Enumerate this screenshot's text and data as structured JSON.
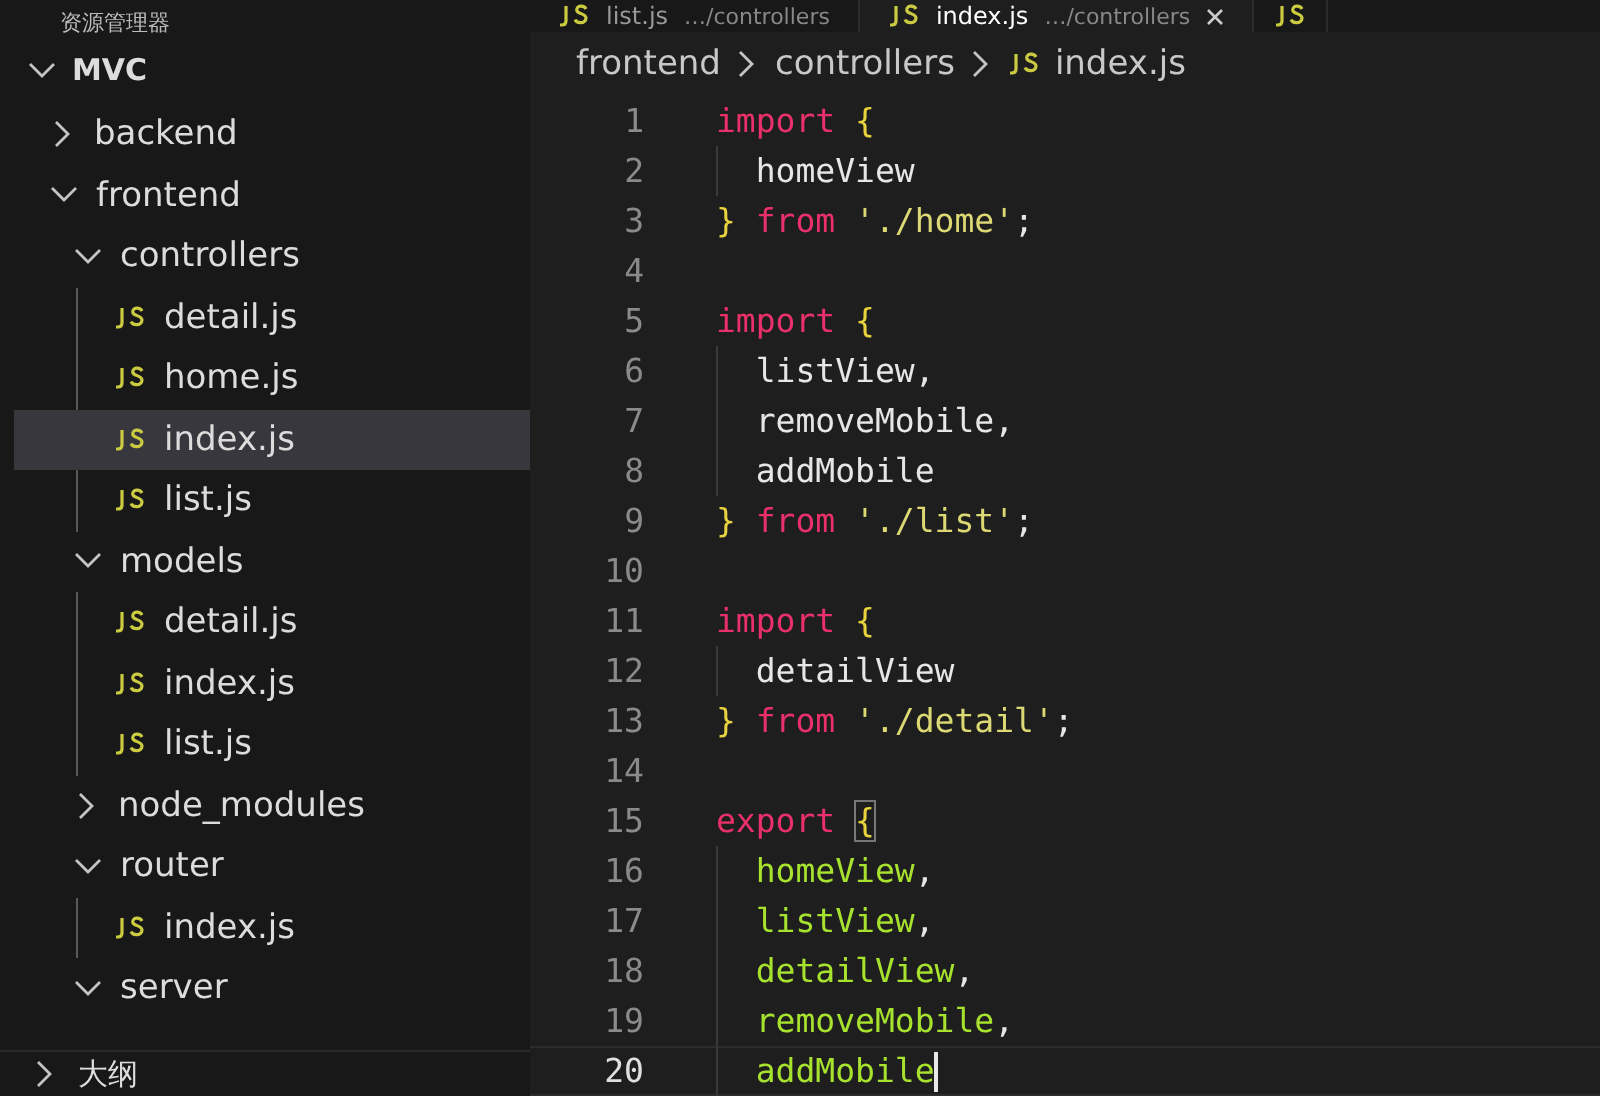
{
  "sidebar": {
    "title": "资源管理器",
    "root": {
      "label": "MVC",
      "expanded": true
    },
    "tree": [
      {
        "kind": "folder",
        "label": "backend",
        "expanded": false,
        "selected": false
      },
      {
        "kind": "folder",
        "label": "frontend",
        "expanded": true,
        "selected": false,
        "children": [
          {
            "kind": "folder",
            "label": "controllers",
            "expanded": true,
            "selected": false,
            "children": [
              {
                "kind": "file",
                "label": "detail.js",
                "selected": false
              },
              {
                "kind": "file",
                "label": "home.js",
                "selected": false
              },
              {
                "kind": "file",
                "label": "index.js",
                "selected": true
              },
              {
                "kind": "file",
                "label": "list.js",
                "selected": false
              }
            ]
          },
          {
            "kind": "folder",
            "label": "models",
            "expanded": true,
            "selected": false,
            "children": [
              {
                "kind": "file",
                "label": "detail.js",
                "selected": false
              },
              {
                "kind": "file",
                "label": "index.js",
                "selected": false
              },
              {
                "kind": "file",
                "label": "list.js",
                "selected": false
              }
            ]
          },
          {
            "kind": "folder",
            "label": "node_modules",
            "expanded": false,
            "selected": false
          },
          {
            "kind": "folder",
            "label": "router",
            "expanded": true,
            "selected": false,
            "children": [
              {
                "kind": "file",
                "label": "index.js",
                "selected": false
              }
            ]
          },
          {
            "kind": "folder",
            "label": "server",
            "expanded": true,
            "selected": false
          }
        ]
      }
    ],
    "outline": {
      "label": "大纲",
      "expanded": false
    }
  },
  "tabs": [
    {
      "label": "list.js",
      "description": "…/controllers",
      "selected": false
    },
    {
      "label": "index.js",
      "description": "…/controllers",
      "selected": true
    }
  ],
  "breadcrumbs": [
    "frontend",
    "controllers",
    "index.js"
  ],
  "code": {
    "lines": [
      {
        "number": "1",
        "current": false,
        "tokens": [
          {
            "kind": "keyword",
            "text": "import"
          },
          {
            "kind": "brace",
            "text": " {"
          }
        ]
      },
      {
        "number": "2",
        "current": false,
        "tokens": [
          {
            "kind": "plain",
            "text": "  homeView"
          }
        ]
      },
      {
        "number": "3",
        "current": false,
        "tokens": [
          {
            "kind": "brace",
            "text": "}"
          },
          {
            "kind": "keyword",
            "text": " from"
          },
          {
            "kind": "string",
            "text": " './home'"
          },
          {
            "kind": "plain",
            "text": ";"
          }
        ]
      },
      {
        "number": "4",
        "current": false
      },
      {
        "number": "5",
        "current": false,
        "tokens": [
          {
            "kind": "keyword",
            "text": "import"
          },
          {
            "kind": "brace",
            "text": " {"
          }
        ]
      },
      {
        "number": "6",
        "current": false,
        "tokens": [
          {
            "kind": "plain",
            "text": "  listView,"
          }
        ]
      },
      {
        "number": "7",
        "current": false,
        "tokens": [
          {
            "kind": "plain",
            "text": "  removeMobile,"
          }
        ]
      },
      {
        "number": "8",
        "current": false,
        "tokens": [
          {
            "kind": "plain",
            "text": "  addMobile"
          }
        ]
      },
      {
        "number": "9",
        "current": false,
        "tokens": [
          {
            "kind": "brace",
            "text": "}"
          },
          {
            "kind": "keyword",
            "text": " from"
          },
          {
            "kind": "string",
            "text": " './list'"
          },
          {
            "kind": "plain",
            "text": ";"
          }
        ]
      },
      {
        "number": "10",
        "current": false
      },
      {
        "number": "11",
        "current": false,
        "tokens": [
          {
            "kind": "keyword",
            "text": "import"
          },
          {
            "kind": "brace",
            "text": " {"
          }
        ]
      },
      {
        "number": "12",
        "current": false,
        "tokens": [
          {
            "kind": "plain",
            "text": "  detailView"
          }
        ]
      },
      {
        "number": "13",
        "current": false,
        "tokens": [
          {
            "kind": "brace",
            "text": "}"
          },
          {
            "kind": "keyword",
            "text": " from"
          },
          {
            "kind": "string",
            "text": " './detail'"
          },
          {
            "kind": "plain",
            "text": ";"
          }
        ]
      },
      {
        "number": "14",
        "current": false
      },
      {
        "number": "15",
        "current": false,
        "tokens": [
          {
            "kind": "keyword",
            "text": "export"
          },
          {
            "kind": "matched-brace",
            "text": "{"
          }
        ]
      },
      {
        "number": "16",
        "current": false,
        "tokens": [
          {
            "kind": "export-name",
            "text": "  homeView"
          },
          {
            "kind": "plain",
            "text": ","
          }
        ]
      },
      {
        "number": "17",
        "current": false,
        "tokens": [
          {
            "kind": "export-name",
            "text": "  listView"
          },
          {
            "kind": "plain",
            "text": ","
          }
        ]
      },
      {
        "number": "18",
        "current": false,
        "tokens": [
          {
            "kind": "export-name",
            "text": "  detailView"
          },
          {
            "kind": "plain",
            "text": ","
          }
        ]
      },
      {
        "number": "19",
        "current": false,
        "tokens": [
          {
            "kind": "export-name",
            "text": "  removeMobile"
          },
          {
            "kind": "plain",
            "text": ","
          }
        ]
      },
      {
        "number": "20",
        "current": true,
        "tokens": [
          {
            "kind": "export-name",
            "text": "  addMobile"
          }
        ]
      }
    ]
  }
}
